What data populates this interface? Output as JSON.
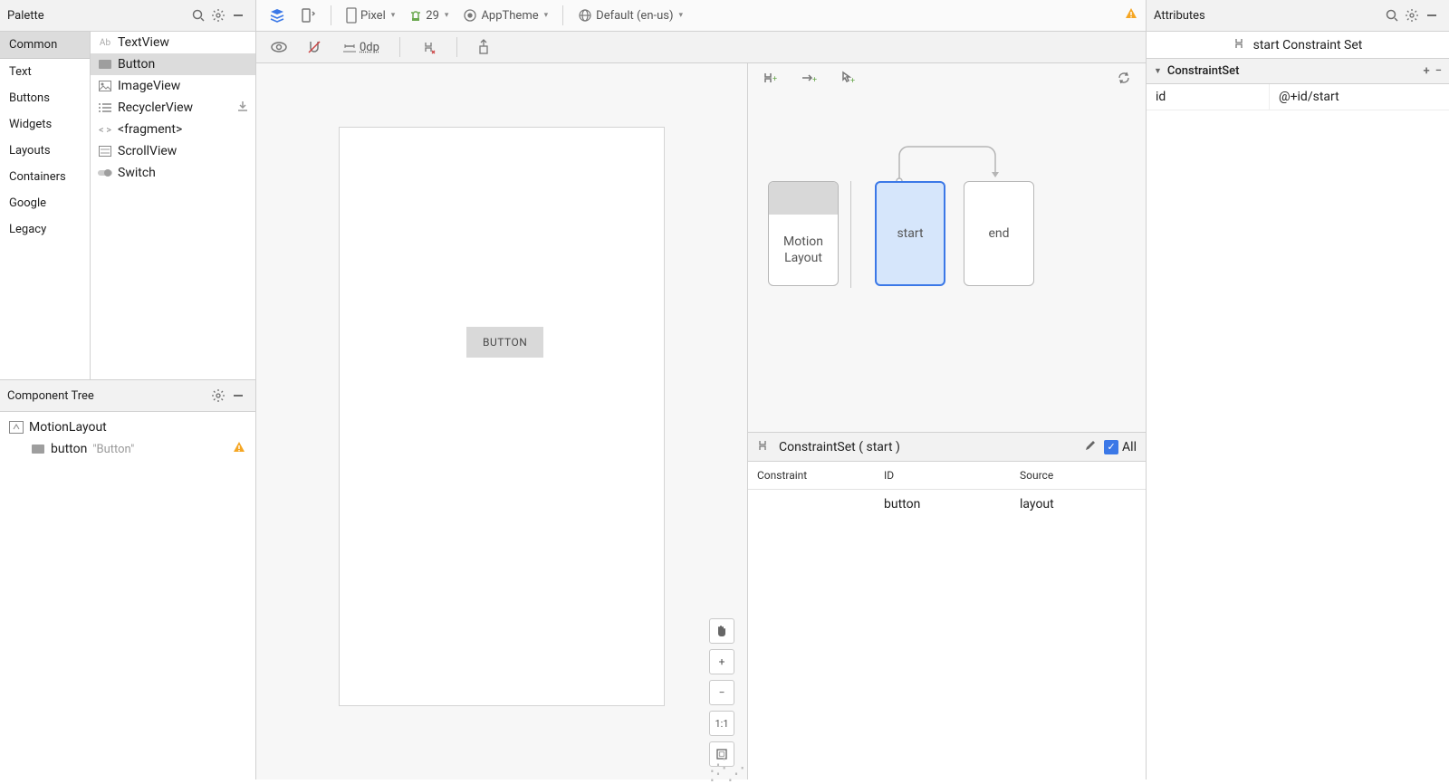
{
  "palette": {
    "title": "Palette",
    "categories": [
      "Common",
      "Text",
      "Buttons",
      "Widgets",
      "Layouts",
      "Containers",
      "Google",
      "Legacy"
    ],
    "selected_category": "Common",
    "items": [
      {
        "label": "TextView",
        "icon": "ab"
      },
      {
        "label": "Button",
        "icon": "rect",
        "selected": true
      },
      {
        "label": "ImageView",
        "icon": "img"
      },
      {
        "label": "RecyclerView",
        "icon": "list",
        "download": true
      },
      {
        "label": "<fragment>",
        "icon": "tag"
      },
      {
        "label": "ScrollView",
        "icon": "scroll"
      },
      {
        "label": "Switch",
        "icon": "switch"
      }
    ]
  },
  "component_tree": {
    "title": "Component Tree",
    "root": "MotionLayout",
    "child": {
      "id": "button",
      "text": "\"Button\"",
      "warning": true
    }
  },
  "toolbar": {
    "device": "Pixel",
    "api": "29",
    "theme": "AppTheme",
    "locale": "Default (en-us)",
    "default_margin": "0dp"
  },
  "canvas": {
    "button_label": "BUTTON",
    "zoom_ratio": "1:1"
  },
  "motion": {
    "boxes": {
      "motion_layout": "Motion\nLayout",
      "start": "start",
      "end": "end"
    },
    "constraint_header": "ConstraintSet ( start )",
    "all_label": "All",
    "columns": {
      "constraint": "Constraint",
      "id": "ID",
      "source": "Source"
    },
    "row": {
      "constraint": "",
      "id": "button",
      "source": "layout"
    }
  },
  "attributes": {
    "title": "Attributes",
    "sub": "start Constraint Set",
    "section": "ConstraintSet",
    "rows": [
      {
        "key": "id",
        "value": "@+id/start"
      }
    ]
  }
}
